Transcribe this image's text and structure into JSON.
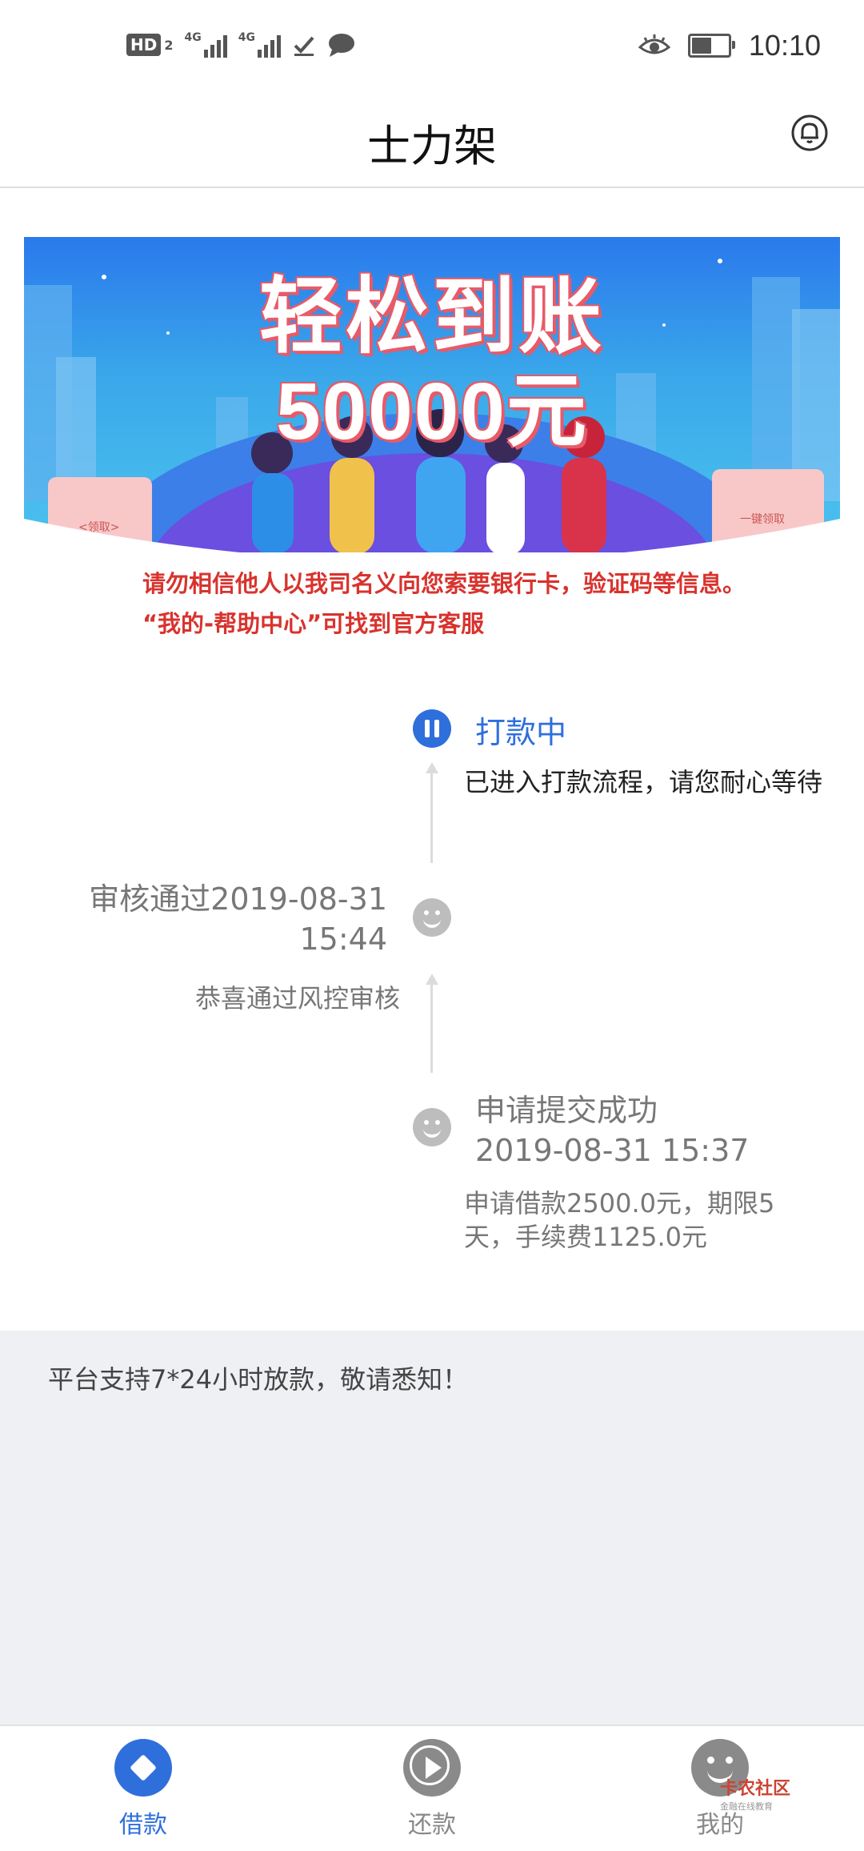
{
  "status_bar": {
    "hd_label": "HD",
    "hd_sub": "2",
    "signal1_label": "4G",
    "signal2_label": "4G",
    "time": "10:10",
    "battery_level": 0.55,
    "icons": [
      "check-icon",
      "message-icon",
      "eye-icon",
      "battery-icon"
    ]
  },
  "header": {
    "title": "士力架",
    "bell_icon": "bell-icon"
  },
  "banner": {
    "headline": "轻松到账",
    "amount": "50000元",
    "left_button": "<领取>",
    "right_button": "一键领取"
  },
  "warning": {
    "line1": "请勿相信他人以我司名义向您索要银行卡，验证码等信息。",
    "line2": "“我的-帮助中心”可找到官方客服"
  },
  "timeline": {
    "current": {
      "title": "打款中",
      "desc": "已进入打款流程，请您耐心等待",
      "icon": "pause-icon"
    },
    "approved": {
      "title_line1": "审核通过2019-08-31",
      "title_line2": "15:44",
      "desc": "恭喜通过风控审核",
      "icon": "smiley-icon"
    },
    "submitted": {
      "title_line1": "申请提交成功",
      "title_line2": "2019-08-31 15:37",
      "desc": "申请借款2500.0元，期限5天，手续费1125.0元",
      "icon": "smiley-icon"
    }
  },
  "notice": {
    "text": "平台支持7*24小时放款，敬请悉知！"
  },
  "tabbar": {
    "tabs": [
      {
        "label": "借款",
        "icon": "diamond-icon",
        "active": true
      },
      {
        "label": "还款",
        "icon": "play-icon",
        "active": false
      },
      {
        "label": "我的",
        "icon": "smiley-icon",
        "active": false
      }
    ],
    "active_color": "#2f6fdc",
    "inactive_color": "#888888"
  },
  "watermark": {
    "brand": "卡农社区",
    "sub": "金融在线教育"
  }
}
